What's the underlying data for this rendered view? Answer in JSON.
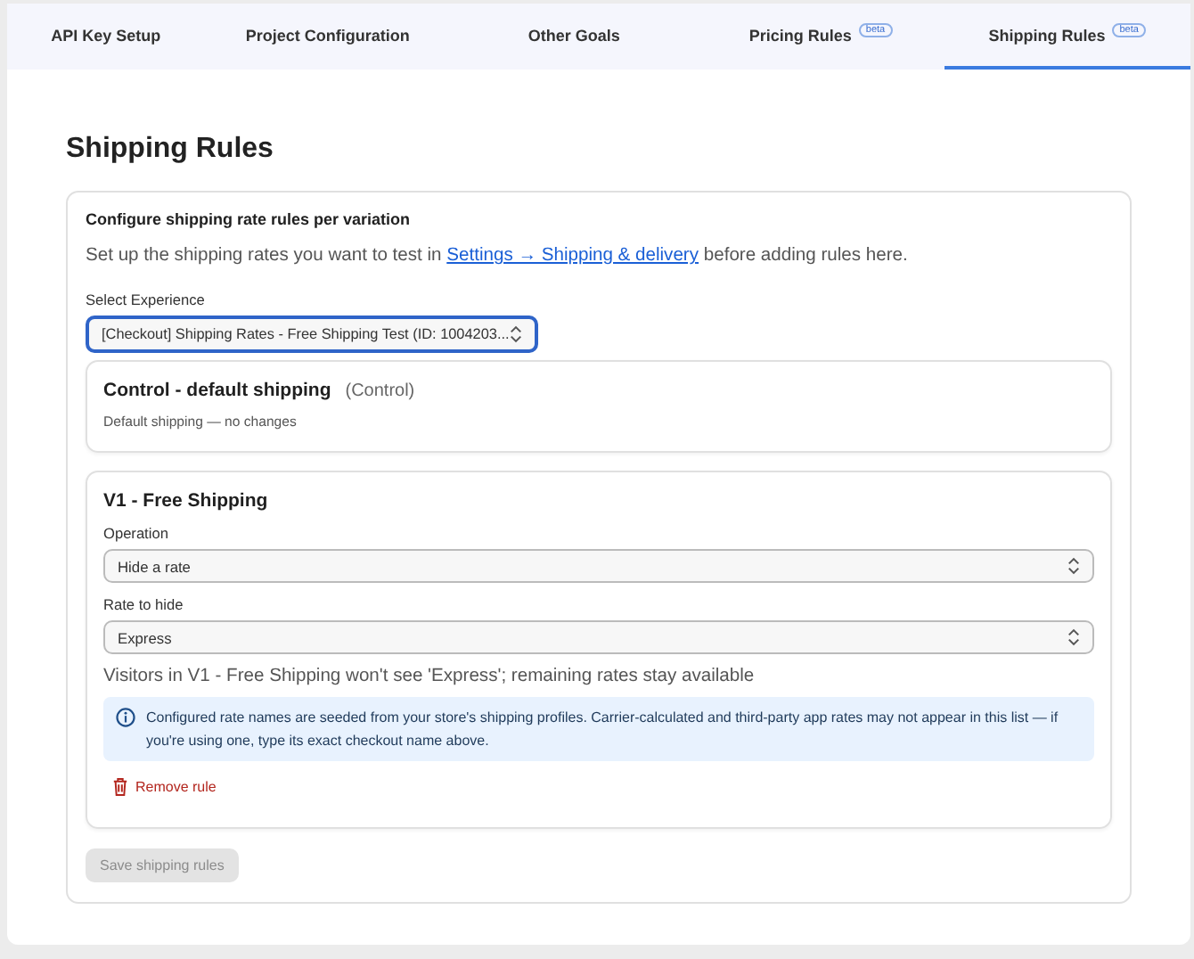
{
  "tabs": [
    {
      "label": "API Key Setup",
      "selected": false
    },
    {
      "label": "Project Configuration",
      "selected": false
    },
    {
      "label": "Other Goals",
      "selected": false
    },
    {
      "label": "Pricing Rules",
      "badge": "beta",
      "selected": false
    },
    {
      "label": "Shipping Rules",
      "badge": "beta",
      "selected": true
    }
  ],
  "page_title": "Shipping Rules",
  "card": {
    "title": "Configure shipping rate rules per variation",
    "intro": {
      "before": "Set up the shipping rates you want to test in ",
      "link": "Settings → Shipping & delivery",
      "after": " before adding rules here."
    },
    "experience": {
      "label": "Select Experience",
      "value": "[Checkout] Shipping Rates - Free Shipping Test (ID: 1004203..."
    },
    "variations": [
      {
        "kind": "control",
        "name": "Control - default shipping",
        "tag": "(Control)",
        "note": "Default shipping — no changes"
      },
      {
        "kind": "rule",
        "name": "V1 - Free Shipping",
        "fields": [
          {
            "label": "Operation",
            "value": "Hide a rate"
          },
          {
            "label": "Rate to hide",
            "value": "Express"
          }
        ],
        "summary": "Visitors in V1 - Free Shipping won't see 'Express'; remaining rates stay available",
        "info": "Configured rate names are seeded from your store's shipping profiles. Carrier-calculated and third-party app rates may not appear in this list — if you're using one, type its exact checkout name above.",
        "remove": "Remove rule"
      }
    ],
    "save": {
      "label": "Save shipping rules",
      "disabled": true
    }
  }
}
